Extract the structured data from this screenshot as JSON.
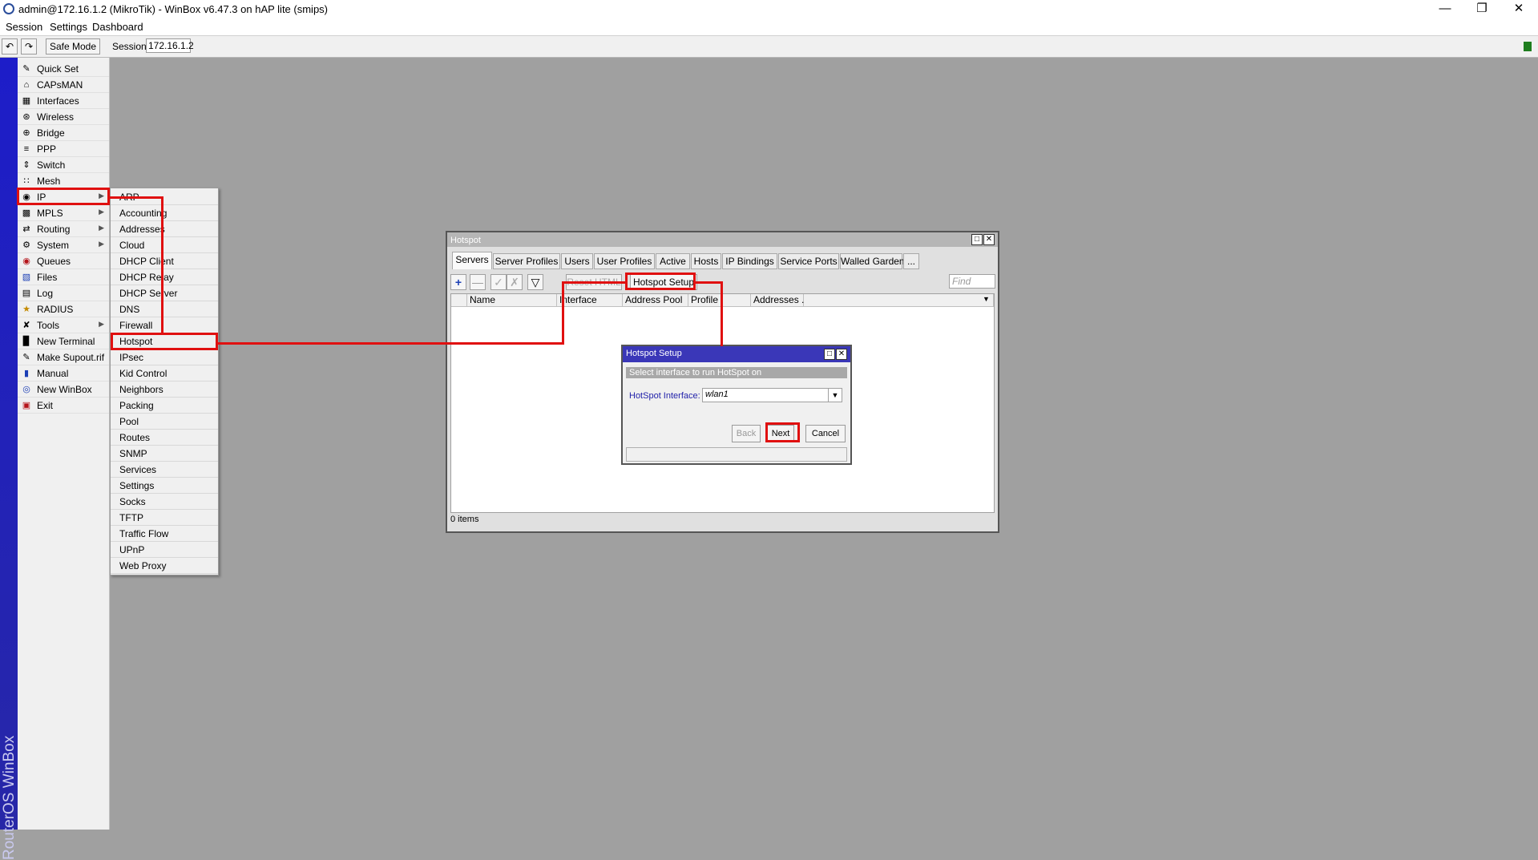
{
  "window": {
    "title": "admin@172.16.1.2 (MikroTik) - WinBox v6.47.3 on hAP lite (smips)",
    "controls": [
      "minimize",
      "maximize",
      "close"
    ]
  },
  "menubar": {
    "items": [
      "Session",
      "Settings",
      "Dashboard"
    ]
  },
  "toolbar": {
    "safe_mode": "Safe Mode",
    "session_label": "Session:",
    "session_value": "172.16.1.2"
  },
  "brand_strip": "RouterOS WinBox",
  "sidebar": {
    "items": [
      {
        "label": "Quick Set",
        "icon": "quickset-icon",
        "submenu": false
      },
      {
        "label": "CAPsMAN",
        "icon": "capsman-icon",
        "submenu": false
      },
      {
        "label": "Interfaces",
        "icon": "interfaces-icon",
        "submenu": false
      },
      {
        "label": "Wireless",
        "icon": "wireless-icon",
        "submenu": false
      },
      {
        "label": "Bridge",
        "icon": "bridge-icon",
        "submenu": false
      },
      {
        "label": "PPP",
        "icon": "ppp-icon",
        "submenu": false
      },
      {
        "label": "Switch",
        "icon": "switch-icon",
        "submenu": false
      },
      {
        "label": "Mesh",
        "icon": "mesh-icon",
        "submenu": false
      },
      {
        "label": "IP",
        "icon": "ip-icon",
        "submenu": true
      },
      {
        "label": "MPLS",
        "icon": "mpls-icon",
        "submenu": true
      },
      {
        "label": "Routing",
        "icon": "routing-icon",
        "submenu": true
      },
      {
        "label": "System",
        "icon": "system-icon",
        "submenu": true
      },
      {
        "label": "Queues",
        "icon": "queues-icon",
        "submenu": false
      },
      {
        "label": "Files",
        "icon": "files-icon",
        "submenu": false
      },
      {
        "label": "Log",
        "icon": "log-icon",
        "submenu": false
      },
      {
        "label": "RADIUS",
        "icon": "radius-icon",
        "submenu": false
      },
      {
        "label": "Tools",
        "icon": "tools-icon",
        "submenu": true
      },
      {
        "label": "New Terminal",
        "icon": "terminal-icon",
        "submenu": false
      },
      {
        "label": "Make Supout.rif",
        "icon": "supout-icon",
        "submenu": false
      },
      {
        "label": "Manual",
        "icon": "manual-icon",
        "submenu": false
      },
      {
        "label": "New WinBox",
        "icon": "winbox-icon",
        "submenu": false
      },
      {
        "label": "Exit",
        "icon": "exit-icon",
        "submenu": false
      }
    ]
  },
  "ip_submenu": {
    "items": [
      "ARP",
      "Accounting",
      "Addresses",
      "Cloud",
      "DHCP Client",
      "DHCP Relay",
      "DHCP Server",
      "DNS",
      "Firewall",
      "Hotspot",
      "IPsec",
      "Kid Control",
      "Neighbors",
      "Packing",
      "Pool",
      "Routes",
      "SNMP",
      "Services",
      "Settings",
      "Socks",
      "TFTP",
      "Traffic Flow",
      "UPnP",
      "Web Proxy"
    ]
  },
  "hotspot_window": {
    "title": "Hotspot",
    "tabs": [
      "Servers",
      "Server Profiles",
      "Users",
      "User Profiles",
      "Active",
      "Hosts",
      "IP Bindings",
      "Service Ports",
      "Walled Garden",
      "..."
    ],
    "reset_html": "Reset HTML",
    "setup_button": "Hotspot Setup",
    "find_placeholder": "Find",
    "columns": [
      "Name",
      "Interface",
      "Address Pool",
      "Profile",
      "Addresses ..."
    ],
    "status": "0 items"
  },
  "wizard": {
    "title": "Hotspot Setup",
    "header": "Select interface to run HotSpot on",
    "field_label": "HotSpot Interface:",
    "field_value": "wlan1",
    "back": "Back",
    "next": "Next",
    "cancel": "Cancel"
  },
  "colors": {
    "annotation": "#e01010",
    "brand_strip": "#2727a7",
    "wizard_titlebar": "#3a37b8"
  }
}
